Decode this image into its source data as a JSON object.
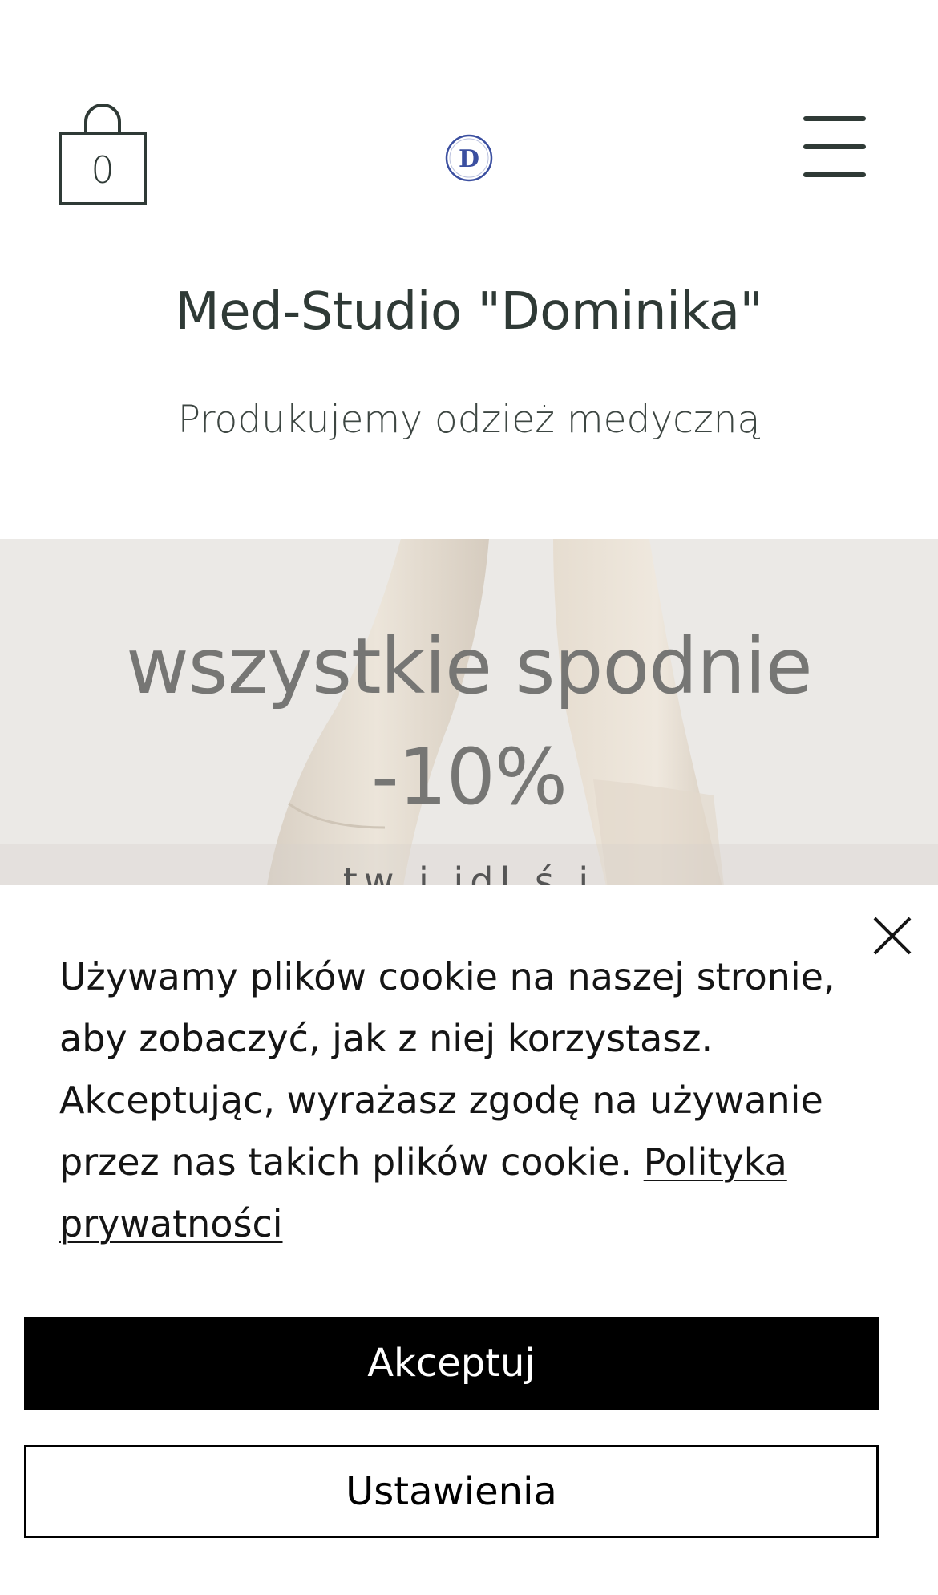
{
  "header": {
    "cart_count": "0",
    "logo_letter": "D",
    "menu_icon": "hamburger-menu-icon",
    "cart_icon": "shopping-bag-icon"
  },
  "site": {
    "title": "Med-Studio \"Dominika\"",
    "subtitle": "Produkujemy odzież medyczną"
  },
  "hero": {
    "headline_line1": "wszystkie spodnie",
    "headline_line2": "-10%",
    "cut_text": "tw     i                 idl      ś   i"
  },
  "cookie_banner": {
    "text": "Używamy plików cookie na naszej stronie, aby zobaczyć, jak z niej korzystasz. Akceptując, wyrażasz zgodę na używanie przez nas takich plików cookie.",
    "privacy_link": "Polityka prywatności",
    "accept_label": "Akceptuj",
    "settings_label": "Ustawienia",
    "close_icon": "close-icon"
  },
  "colors": {
    "text_dark": "#2f3a36",
    "hero_text": "#767674",
    "button_black": "#000000",
    "logo_blue": "#3b4fa0"
  }
}
